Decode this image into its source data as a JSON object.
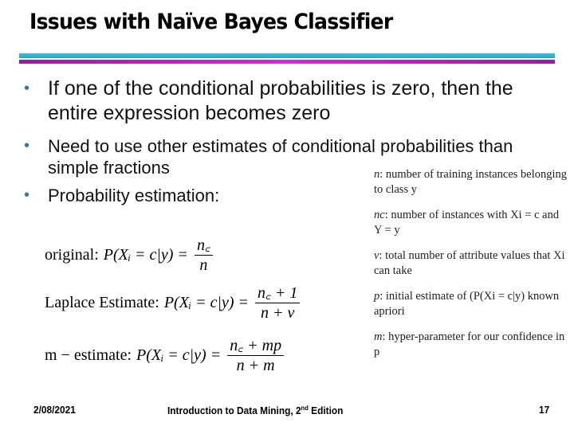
{
  "slide": {
    "title": "Issues with Naïve Bayes Classifier",
    "bullets": [
      "If one of the conditional probabilities is zero, then the entire expression becomes zero",
      "Need to use other estimates of conditional probabilities than simple fractions",
      "Probability estimation:"
    ],
    "bullet_icon": "bullet-dot",
    "accent_colors": {
      "rule_top": "#1fb4d2",
      "rule_bottom": "#b01fb0",
      "bullet": "#2e7fa0"
    }
  },
  "formulas": [
    {
      "label": "original:",
      "lhs": "P(Xᵢ = c|y) =",
      "numerator": "n꜀",
      "denominator": "n"
    },
    {
      "label": "Laplace Estimate:",
      "lhs": "P(Xᵢ = c|y) =",
      "numerator": "n꜀ + 1",
      "denominator": "n + v"
    },
    {
      "label": "m − estimate:",
      "lhs": "P(Xᵢ = c|y) =",
      "numerator": "n꜀ + mp",
      "denominator": "n + m"
    }
  ],
  "definitions": [
    {
      "symbol": "n",
      "text": ": number of training instances belonging to class y"
    },
    {
      "symbol": "nc",
      "text": ": number of instances with Xi = c and Y = y"
    },
    {
      "symbol": "v",
      "text": ": total number of attribute values that Xi can take"
    },
    {
      "symbol": "p",
      "text": ": initial estimate of (P(Xi = c|y) known apriori"
    },
    {
      "symbol": "m",
      "text": ": hyper-parameter for our confidence in p"
    }
  ],
  "footer": {
    "date": "2/08/2021",
    "title_prefix": "Introduction to Data Mining, 2",
    "title_sup": "nd",
    "title_suffix": " Edition",
    "page": "17"
  }
}
